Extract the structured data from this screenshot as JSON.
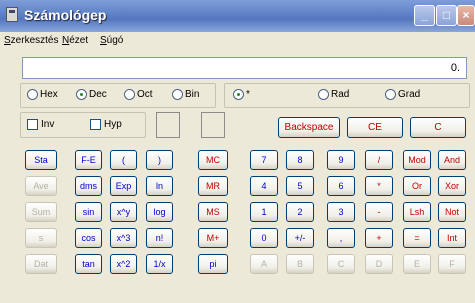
{
  "window": {
    "title": "Számológep"
  },
  "title_buttons": {
    "minimize": "_",
    "maximize": "□",
    "close": "×"
  },
  "menu": {
    "items": [
      "Szerkesztés",
      "Nézet",
      "Súgó"
    ]
  },
  "display": {
    "value": "0."
  },
  "base": {
    "options": [
      "Hex",
      "Dec",
      "Oct",
      "Bin"
    ],
    "selected": "Dec"
  },
  "angle": {
    "options": [
      "*",
      "Rad",
      "Grad"
    ],
    "selected": "*"
  },
  "checks": {
    "inv": "Inv",
    "hyp": "Hyp"
  },
  "controls": {
    "backspace": "Backspace",
    "ce": "CE",
    "c": "C"
  },
  "buttons": {
    "sta": "Sta",
    "ave": "Ave",
    "sum": "Sum",
    "s": "s",
    "dat": "Dat",
    "fe": "F-E",
    "lparen": "(",
    "rparen": ")",
    "dms": "dms",
    "exp": "Exp",
    "ln": "ln",
    "sin": "sin",
    "xy": "x^y",
    "log": "log",
    "cos": "cos",
    "x3": "x^3",
    "nfact": "n!",
    "tan": "tan",
    "x2": "x^2",
    "inv_x": "1/x",
    "mc": "MC",
    "mr": "MR",
    "ms": "MS",
    "mplus": "M+",
    "pi": "pi",
    "n7": "7",
    "n8": "8",
    "n9": "9",
    "div": "/",
    "mod": "Mod",
    "and": "And",
    "n4": "4",
    "n5": "5",
    "n6": "6",
    "mul": "*",
    "or": "Or",
    "xor": "Xor",
    "n1": "1",
    "n2": "2",
    "n3": "3",
    "sub": "-",
    "lsh": "Lsh",
    "not": "Not",
    "n0": "0",
    "sign": "+/-",
    "dot": ",",
    "add": "+",
    "eq": "=",
    "int": "Int",
    "a": "A",
    "b": "B",
    "c_hex": "C",
    "d": "D",
    "e": "E",
    "f": "F"
  },
  "colors": {
    "titlebar": "#5d80c8",
    "body": "#ece9d8",
    "red_text": "#c00000",
    "blue_text": "#0000cc"
  }
}
